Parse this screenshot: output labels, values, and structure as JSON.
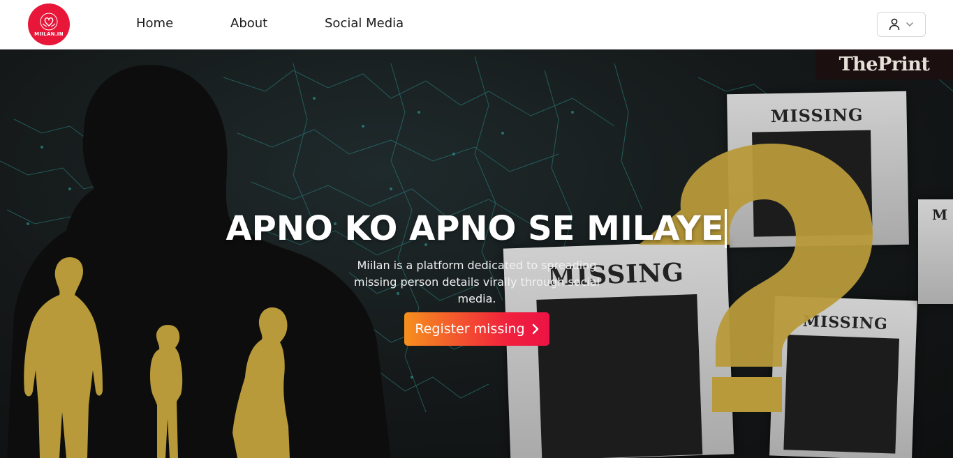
{
  "brand": {
    "logo_text": "MIILAN.IN",
    "accent": "#e8173a"
  },
  "nav": {
    "items": [
      {
        "label": "Home"
      },
      {
        "label": "About"
      },
      {
        "label": "Social Media"
      }
    ],
    "user_icon": "user-icon",
    "dropdown_icon": "chevron-down-icon"
  },
  "hero": {
    "watermark": "ThePrint",
    "posters": [
      {
        "label": "MISSING"
      },
      {
        "label": "MISSING"
      },
      {
        "label": "MISSING"
      },
      {
        "label": "M"
      }
    ],
    "title": "APNO KO APNO SE MILAYE",
    "subtitle": "Miilan is a platform dedicated to spreading missing person details virally through social media.",
    "cta_label": "Register missing",
    "cta_icon": "chevron-right-icon",
    "colors": {
      "cta_start": "#f6901e",
      "cta_end": "#ec1345",
      "silhouette_gold": "#b89a3a"
    }
  }
}
